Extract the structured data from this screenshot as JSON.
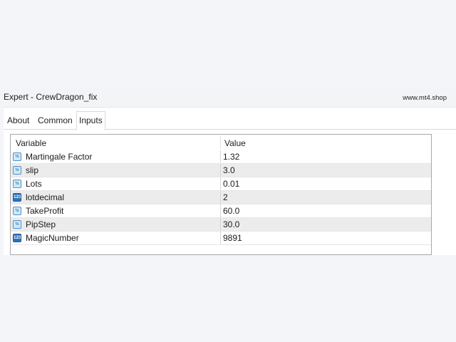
{
  "window": {
    "title": "Expert - CrewDragon_fix",
    "watermark": "www.mt4.shop"
  },
  "tabs": [
    {
      "label": "About",
      "active": false
    },
    {
      "label": "Common",
      "active": false
    },
    {
      "label": "Inputs",
      "active": true
    }
  ],
  "table": {
    "headers": {
      "variable": "Variable",
      "value": "Value"
    },
    "rows": [
      {
        "icon": "double-type-icon",
        "name": "Martingale Factor",
        "value": "1.32"
      },
      {
        "icon": "double-type-icon",
        "name": "slip",
        "value": "3.0"
      },
      {
        "icon": "double-type-icon",
        "name": "Lots",
        "value": "0.01"
      },
      {
        "icon": "integer-type-icon",
        "name": "lotdecimal",
        "value": "2"
      },
      {
        "icon": "double-type-icon",
        "name": "TakeProfit",
        "value": "60.0"
      },
      {
        "icon": "double-type-icon",
        "name": "PipStep",
        "value": "30.0"
      },
      {
        "icon": "integer-type-icon",
        "name": "MagicNumber",
        "value": "9891"
      }
    ]
  },
  "icon_glyphs": {
    "double": "½",
    "integer": "123"
  }
}
